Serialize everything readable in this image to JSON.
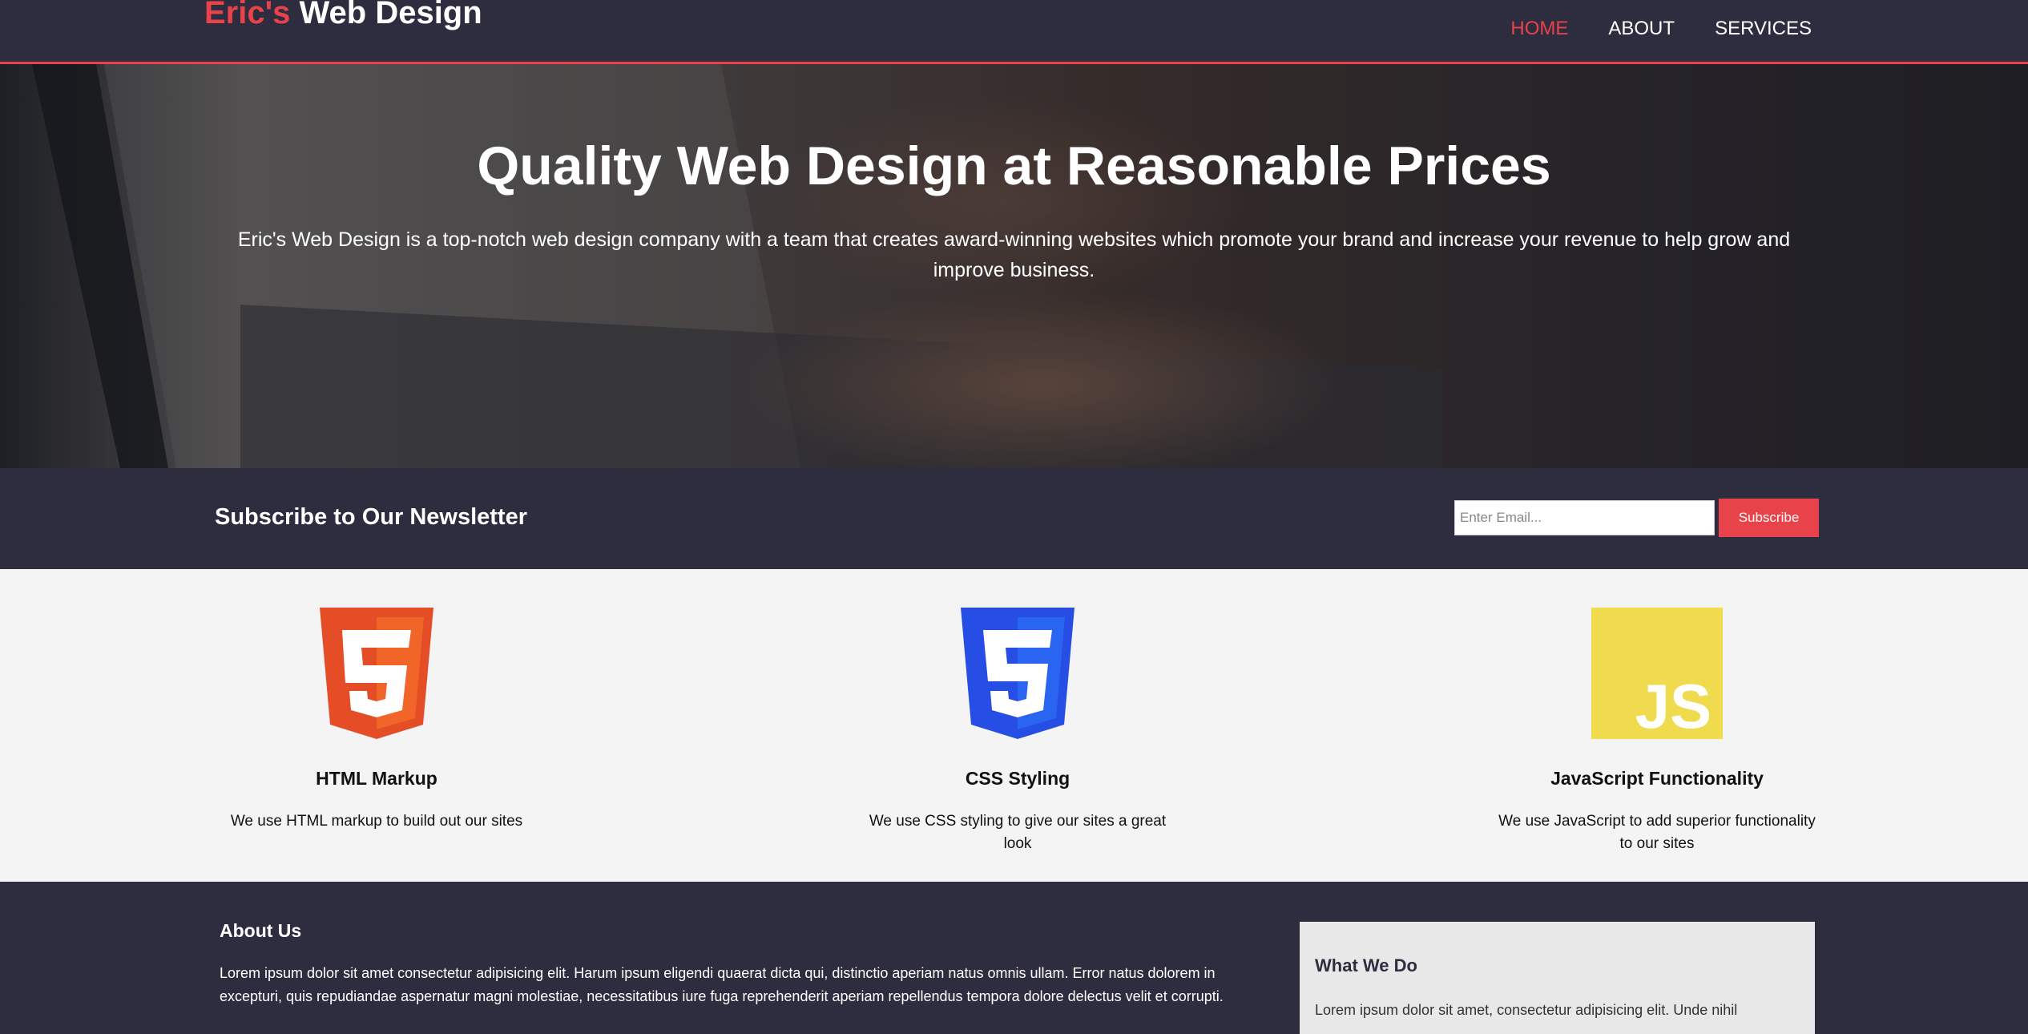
{
  "nav": {
    "logo_accent": "Eric's",
    "logo_rest": " Web Design",
    "items": [
      {
        "label": "HOME",
        "active": true
      },
      {
        "label": "ABOUT",
        "active": false
      },
      {
        "label": "SERVICES",
        "active": false
      }
    ]
  },
  "hero": {
    "title": "Quality Web Design at Reasonable Prices",
    "subtitle": "Eric's Web Design is a top-notch web design company with a team that creates award-winning websites which promote your brand and increase your revenue to help grow and improve business."
  },
  "newsletter": {
    "heading": "Subscribe to Our Newsletter",
    "email_placeholder": "Enter Email...",
    "button_label": "Subscribe"
  },
  "features": [
    {
      "icon": "html5-icon",
      "title": "HTML Markup",
      "text": "We use HTML markup to build out our sites"
    },
    {
      "icon": "css3-icon",
      "title": "CSS Styling",
      "text": "We use CSS styling to give our sites a great look"
    },
    {
      "icon": "js-icon",
      "title": "JavaScript Functionality",
      "text": "We use JavaScript to add superior functionality to our sites"
    }
  ],
  "about": {
    "heading": "About Us",
    "text": "Lorem ipsum dolor sit amet consectetur adipisicing elit. Harum ipsum eligendi quaerat dicta qui, distinctio aperiam natus omnis ullam. Error natus dolorem in excepturi, quis repudiandae aspernatur magni molestiae, necessitatibus iure fuga reprehenderit aperiam repellendus tempora dolore delectus velit et corrupti."
  },
  "what_we_do": {
    "heading": "What We Do",
    "text": "Lorem ipsum dolor sit amet, consectetur adipisicing elit. Unde nihil"
  },
  "colors": {
    "accent": "#e8424a",
    "dark": "#2e2c3f",
    "light_bg": "#f4f4f4",
    "html5": "#e44d26",
    "css3": "#264de4",
    "js": "#f0db4f"
  }
}
